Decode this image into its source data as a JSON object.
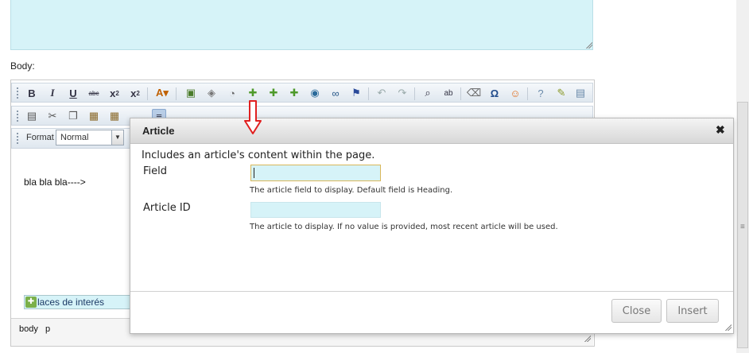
{
  "form": {
    "body_label": "Body:"
  },
  "editor": {
    "format_label": "Format",
    "format_value": "Normal",
    "content_text": "bla bla bla---->",
    "link_text": "laces de interés",
    "path": [
      "body",
      "p"
    ]
  },
  "toolbar_icons": [
    "bold-icon",
    "italic-icon",
    "underline-icon",
    "strikethrough-icon",
    "subscript-icon",
    "superscript-icon",
    "text-color-icon",
    "image-icon",
    "tag-icon",
    "flash-icon",
    "plugin-icon",
    "plugin-icon",
    "plugin-icon",
    "globe-icon",
    "binoculars-icon",
    "flag-icon",
    "undo-icon",
    "redo-icon",
    "find-icon",
    "replace-icon",
    "eraser-icon",
    "omega-icon",
    "smiley-icon",
    "help-icon",
    "edit-icon",
    "save-icon"
  ],
  "dialog": {
    "title": "Article",
    "close_glyph": "✖",
    "description": "Includes an article's content within the page.",
    "field_label": "Field",
    "field_value": "",
    "field_help": "The article field to display. Default field is Heading.",
    "article_id_label": "Article ID",
    "article_id_value": "",
    "article_id_help": "The article to display. If no value is provided, most recent article will be used.",
    "close_button": "Close",
    "insert_button": "Insert"
  },
  "colors": {
    "input_bg": "#d6f3f8",
    "annotation_arrow": "#e02020",
    "focus_border": "#d9b75a"
  }
}
